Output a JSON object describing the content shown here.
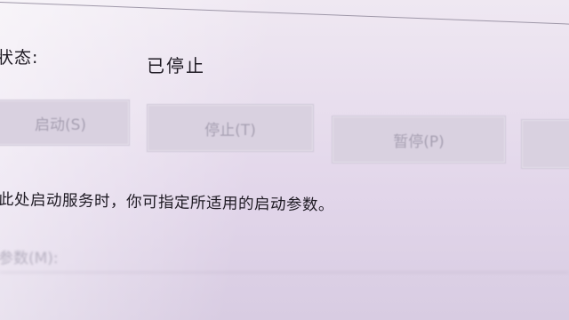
{
  "service": {
    "status_label": "状态:",
    "status_value": "已停止",
    "buttons": {
      "start": "启动(S)",
      "stop": "停止(T)",
      "pause": "暂停(P)",
      "resume": ""
    },
    "hint": "此处启动服务时，你可指定所适用的启动参数。",
    "params_label": "参数(M):"
  }
}
